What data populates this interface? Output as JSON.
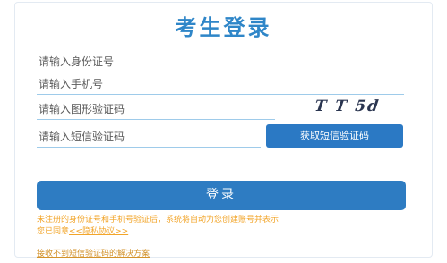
{
  "form": {
    "title": "考生登录",
    "id_placeholder": "请输入身份证号",
    "phone_placeholder": "请输入手机号",
    "captcha_placeholder": "请输入图形验证码",
    "captcha_text": "T T 5d",
    "sms_placeholder": "请输入短信验证码",
    "sms_button_label": "获取短信验证码",
    "login_button_label": "登录",
    "notice_line1": "未注册的身份证号和手机号验证后，系统将自动为您创建账号并表示",
    "notice_line2_prefix": "您已同意",
    "privacy_link": "<<隐私协议>>",
    "help_link": "接收不到短信验证码的解决方案"
  },
  "colors": {
    "title": "#2f86c8",
    "button": "#2e7cc2",
    "notice": "#f2a52a",
    "field_underline": "#9ecbea"
  }
}
